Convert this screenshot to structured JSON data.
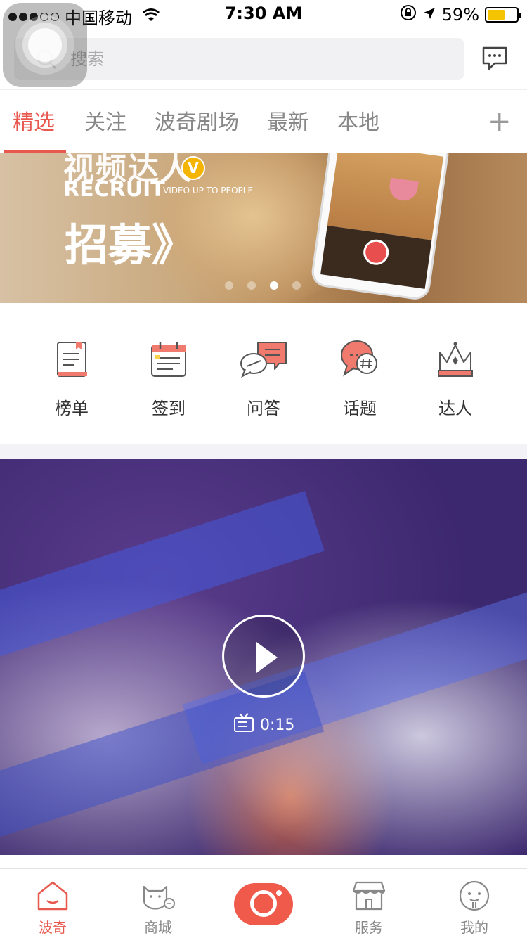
{
  "status_bar": {
    "carrier": "中国移动",
    "time": "7:30 AM",
    "battery": "59%",
    "battery_level": 0.59
  },
  "search": {
    "placeholder": "搜索"
  },
  "tabs": [
    {
      "label": "精选",
      "active": true
    },
    {
      "label": "关注",
      "active": false
    },
    {
      "label": "波奇剧场",
      "active": false
    },
    {
      "label": "最新",
      "active": false
    },
    {
      "label": "本地",
      "active": false
    }
  ],
  "add_tab_label": "+",
  "banner": {
    "title_top": "视频达人",
    "v_badge": "V",
    "recruit": "RECRUIT",
    "subtitle": "VIDEO UP TO PEOPLE",
    "headline": "招募》",
    "page_count": 4,
    "active_page": 3
  },
  "categories": [
    {
      "label": "榜单",
      "icon": "ranking-icon"
    },
    {
      "label": "签到",
      "icon": "calendar-icon"
    },
    {
      "label": "问答",
      "icon": "qa-icon"
    },
    {
      "label": "话题",
      "icon": "topic-icon"
    },
    {
      "label": "达人",
      "icon": "crown-icon"
    }
  ],
  "video": {
    "duration": "0:15"
  },
  "bottom_nav": [
    {
      "label": "波奇",
      "icon": "home-icon",
      "active": true
    },
    {
      "label": "商城",
      "icon": "shop-cat-icon",
      "active": false
    },
    {
      "label": "",
      "icon": "camera-icon",
      "active": false
    },
    {
      "label": "服务",
      "icon": "store-icon",
      "active": false
    },
    {
      "label": "我的",
      "icon": "profile-icon",
      "active": false
    }
  ],
  "colors": {
    "accent": "#e8584e",
    "inactive": "#888888",
    "camera": "#f05a4a"
  }
}
